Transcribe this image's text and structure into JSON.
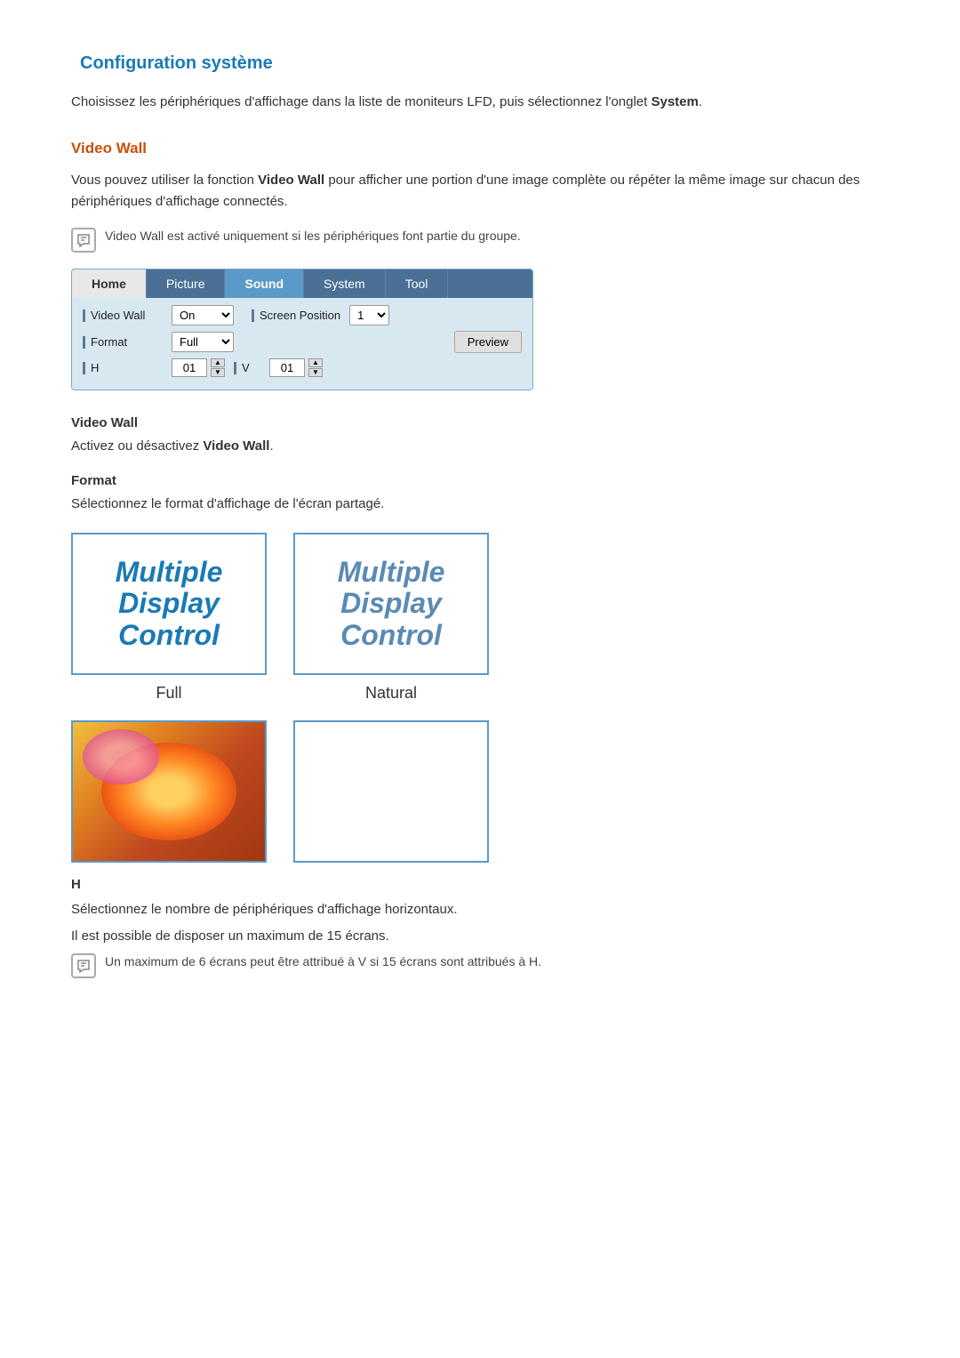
{
  "page": {
    "title": "Configuration système"
  },
  "intro": {
    "text1": "Choisissez les périphériques d'affichage dans la liste de moniteurs LFD, puis sélectionnez l'onglet",
    "bold1": "System",
    "text2": "."
  },
  "video_wall_section": {
    "title": "Video Wall",
    "desc1": "Vous pouvez utiliser la fonction",
    "bold1": "Video Wall",
    "desc2": " pour afficher une portion d'une image complète ou répéter la même image sur chacun des périphériques d'affichage connectés.",
    "note": "Video Wall est activé uniquement si les périphériques font partie du groupe."
  },
  "tabs": {
    "home": "Home",
    "picture": "Picture",
    "sound": "Sound",
    "system": "System",
    "tool": "Tool"
  },
  "panel": {
    "video_wall_label": "Video Wall",
    "on_value": "On",
    "screen_position_label": "Screen Position",
    "screen_position_num": "1",
    "format_label": "Format",
    "full_value": "Full",
    "preview_label": "Preview",
    "h_label": "H",
    "h_value": "01",
    "v_label": "V",
    "v_value": "01"
  },
  "sub_sections": {
    "video_wall": {
      "label": "Video Wall",
      "desc": "Activez ou désactivez",
      "bold": "Video Wall",
      "desc2": "."
    },
    "format": {
      "label": "Format",
      "desc": "Sélectionnez le format d'affichage de l'écran partagé."
    },
    "format_options": [
      {
        "label": "Full"
      },
      {
        "label": "Natural"
      }
    ],
    "h": {
      "label": "H",
      "desc1": "Sélectionnez le nombre de périphériques d'affichage horizontaux.",
      "desc2": "Il est possible de disposer un maximum de 15 écrans.",
      "note": "Un maximum de 6 écrans peut être attribué à V si 15 écrans sont attribués à H."
    }
  }
}
